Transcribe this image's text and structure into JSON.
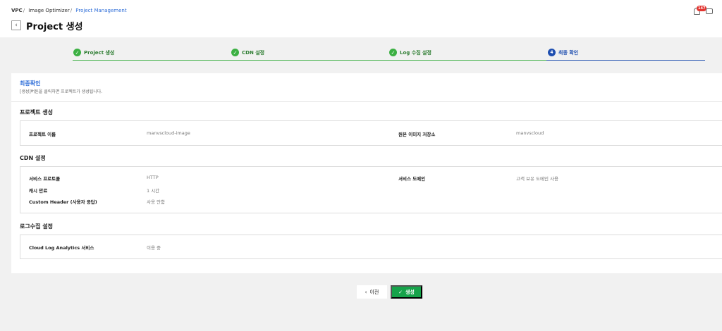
{
  "breadcrumb": {
    "items": [
      "VPC",
      "Image Optimizer",
      "Project Management"
    ],
    "separator": "/"
  },
  "page": {
    "title": "Project 생성",
    "back_icon": "chevron-left-icon"
  },
  "notifications": {
    "badge_count": "147",
    "bell_icon": "bell-icon",
    "chat_icon": "chat-icon"
  },
  "steps": [
    {
      "label": "Project 생성",
      "status": "done",
      "mark": "✓"
    },
    {
      "label": "CDN 설정",
      "status": "done",
      "mark": "✓"
    },
    {
      "label": "Log 수집 설정",
      "status": "done",
      "mark": "✓"
    },
    {
      "label": "최종 확인",
      "status": "current",
      "mark": "4"
    }
  ],
  "final": {
    "title": "최종확인",
    "description": "[생성]버튼을 클릭하면 프로젝트가 생성됩니다."
  },
  "sections": {
    "project": {
      "title": "프로젝트 생성",
      "name_label": "프로젝트 이름",
      "name_value": "manvscloud-image",
      "storage_label": "원본 이미지 저장소",
      "storage_value": "manvscloud"
    },
    "cdn": {
      "title": "CDN 설정",
      "protocol_label": "서비스 프로토콜",
      "protocol_value": "HTTP",
      "cache_label": "캐시 만료",
      "cache_value": "1 시간",
      "header_label": "Custom Header (사용자 응답)",
      "header_value": "사용 안함",
      "domain_label": "서비스 도메인",
      "domain_value": "고객 보유 도메인 사용"
    },
    "log": {
      "title": "로그수집 설정",
      "cla_label": "Cloud Log Analytics 서비스",
      "cla_value": "이용 중"
    }
  },
  "footer": {
    "prev_label": "이전",
    "create_label": "생성",
    "prev_icon": "chevron-left-icon",
    "create_icon": "check-icon"
  },
  "colors": {
    "accent_blue": "#2f6ed8",
    "step_done": "#3cb043",
    "step_current": "#1f4fb0",
    "create_button": "#16a34a",
    "badge": "#e3342f"
  }
}
